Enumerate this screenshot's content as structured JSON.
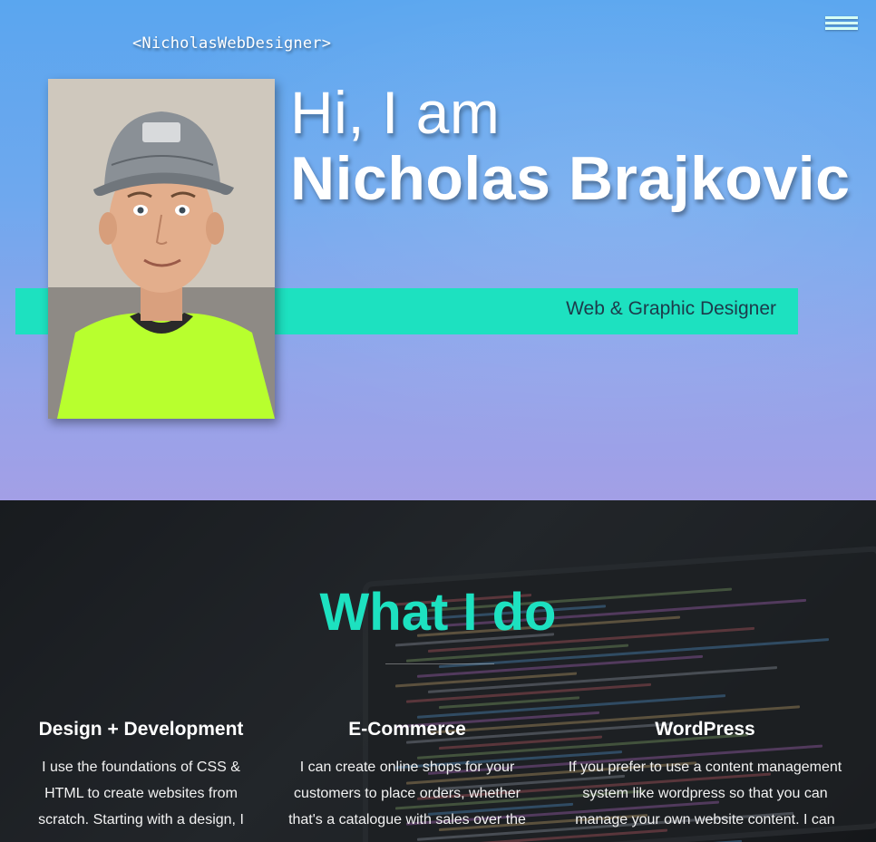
{
  "header": {
    "brand": "<NicholasWebDesigner>",
    "menu_icon": "hamburger-menu-icon"
  },
  "hero": {
    "greeting": "Hi, I am",
    "name": "Nicholas Brajkovic",
    "role": "Web & Graphic Designer",
    "portrait_alt": "Portrait photo"
  },
  "colors": {
    "accent": "#1de1c0",
    "hero_top": "#5aa6ef",
    "hero_bottom": "#a39fe6",
    "dark_bg": "#1b1e22"
  },
  "services_section": {
    "title": "What I do",
    "items": [
      {
        "title": "Design + Development",
        "text": "I use the foundations of CSS & HTML to create websites from scratch. Starting with a design, I"
      },
      {
        "title": "E-Commerce",
        "text": "I can create online shops for your customers to place orders, whether that's a catalogue with sales over the"
      },
      {
        "title": "WordPress",
        "text": "If you prefer to use a content management system like wordpress so that you can manage your own website content. I can"
      }
    ]
  }
}
